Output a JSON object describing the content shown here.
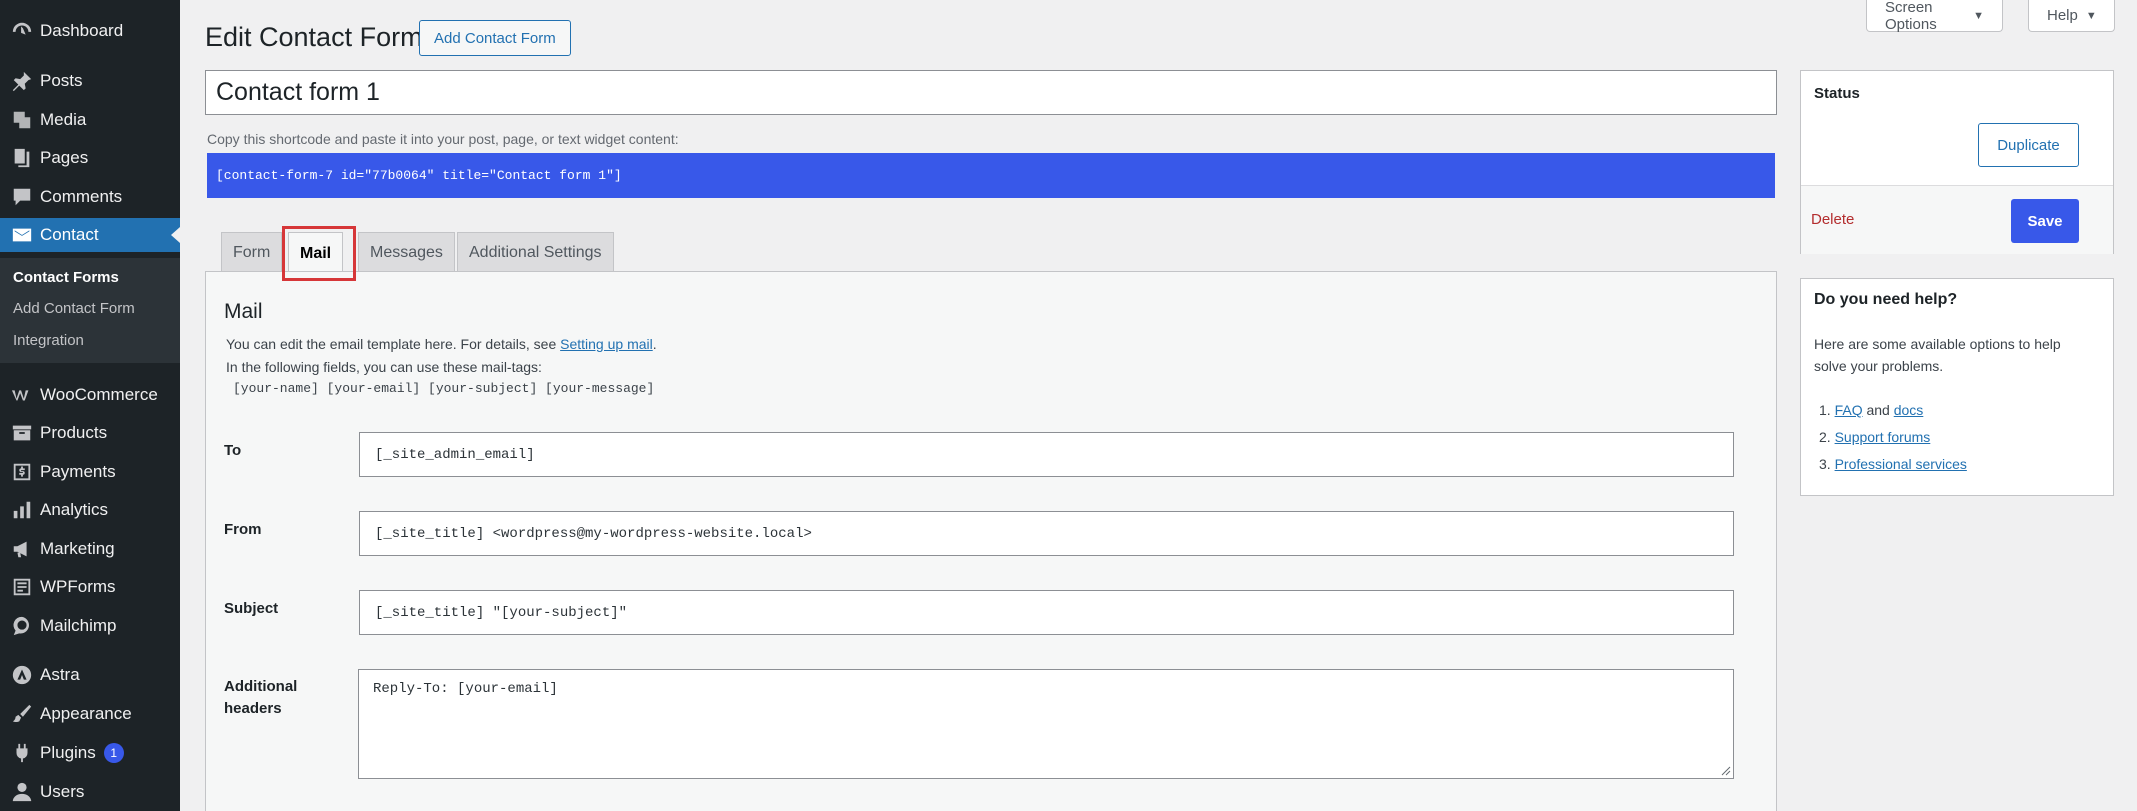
{
  "sidebar": {
    "items": [
      {
        "label": "Dashboard",
        "icon": "dashboard-icon"
      },
      {
        "label": "Posts",
        "icon": "pin-icon"
      },
      {
        "label": "Media",
        "icon": "media-icon"
      },
      {
        "label": "Pages",
        "icon": "pages-icon"
      },
      {
        "label": "Comments",
        "icon": "comment-icon"
      },
      {
        "label": "Contact",
        "icon": "mail-icon"
      },
      {
        "label": "WooCommerce",
        "icon": "woocommerce-icon"
      },
      {
        "label": "Products",
        "icon": "archive-icon"
      },
      {
        "label": "Payments",
        "icon": "dollar-icon"
      },
      {
        "label": "Analytics",
        "icon": "chart-icon"
      },
      {
        "label": "Marketing",
        "icon": "megaphone-icon"
      },
      {
        "label": "WPForms",
        "icon": "form-icon"
      },
      {
        "label": "Mailchimp",
        "icon": "mailchimp-icon"
      },
      {
        "label": "Astra",
        "icon": "astra-icon"
      },
      {
        "label": "Appearance",
        "icon": "brush-icon"
      },
      {
        "label": "Plugins",
        "icon": "plugin-icon",
        "badge": "1"
      },
      {
        "label": "Users",
        "icon": "user-icon"
      }
    ],
    "submenu": [
      "Contact Forms",
      "Add Contact Form",
      "Integration"
    ]
  },
  "top": {
    "screen_options": "Screen Options",
    "help": "Help"
  },
  "header": {
    "title": "Edit Contact Form",
    "add_button": "Add Contact Form"
  },
  "form": {
    "title_value": "Contact form 1",
    "shortcode_hint": "Copy this shortcode and paste it into your post, page, or text widget content:",
    "shortcode": "[contact-form-7 id=\"77b0064\" title=\"Contact form 1\"]"
  },
  "tabs": [
    "Form",
    "Mail",
    "Messages",
    "Additional Settings"
  ],
  "mail": {
    "heading": "Mail",
    "desc_prefix": "You can edit the email template here. For details, see ",
    "desc_link": "Setting up mail",
    "desc_suffix": ".",
    "desc_line2": "In the following fields, you can use these mail-tags:",
    "mail_tags": "[your-name] [your-email] [your-subject] [your-message]",
    "fields": {
      "to_label": "To",
      "to_value": "[_site_admin_email]",
      "from_label": "From",
      "from_value": "[_site_title] <wordpress@my-wordpress-website.local>",
      "subject_label": "Subject",
      "subject_value": "[_site_title] \"[your-subject]\"",
      "headers_label": "Additional headers",
      "headers_value": "Reply-To: [your-email]"
    }
  },
  "status": {
    "title": "Status",
    "duplicate": "Duplicate",
    "delete": "Delete",
    "save": "Save"
  },
  "help": {
    "title": "Do you need help?",
    "text": "Here are some available options to help solve your problems.",
    "item1_num": "1.",
    "item1_link_a": "FAQ",
    "item1_and": " and ",
    "item1_link_b": "docs",
    "item2_num": "2.",
    "item2_link": "Support forums",
    "item3_num": "3.",
    "item3_link": "Professional services"
  },
  "colors": {
    "sidebar_bg": "#1d2327",
    "accent": "#3858e9",
    "wp_blue": "#2271b1",
    "delete_red": "#b32d2e",
    "highlight_red": "#d63638"
  }
}
